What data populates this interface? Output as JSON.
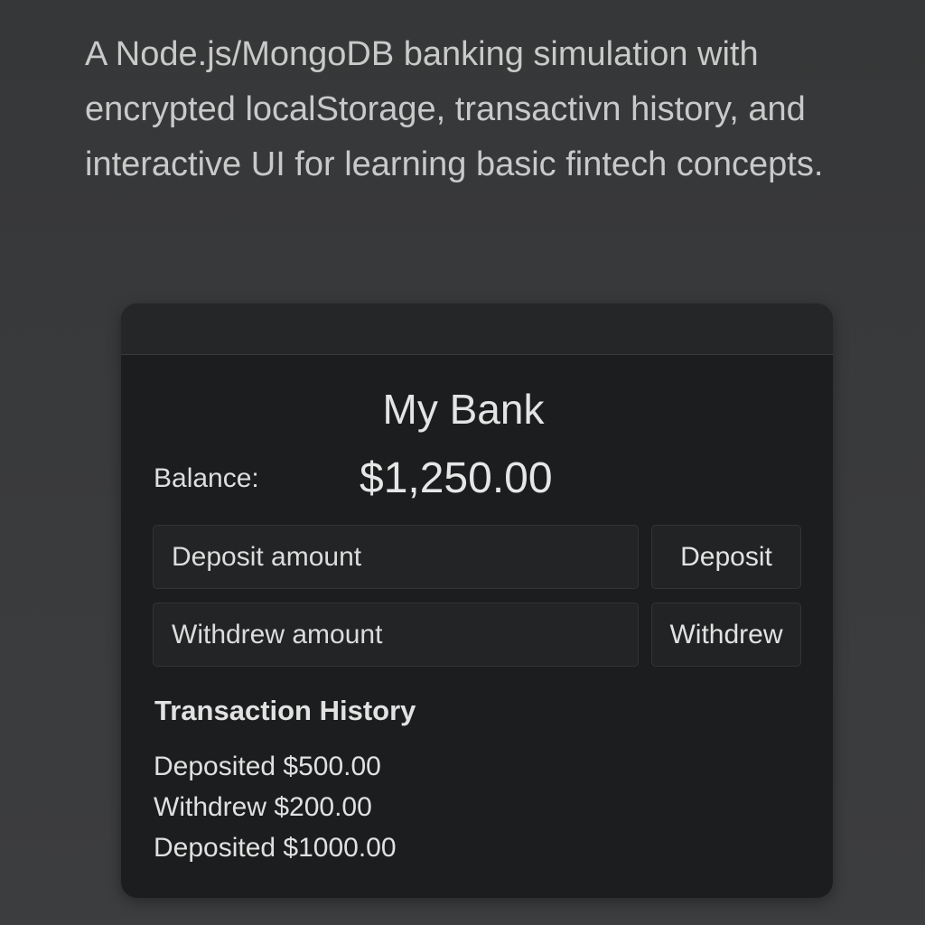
{
  "description": "A Node.js/MongoDB banking simulation with encrypted localStorage, transactivn history, and interactive UI for learning basic fintech concepts.",
  "app": {
    "title": "My Bank",
    "balance_label": "Balance:",
    "balance_value": "$1,250.00"
  },
  "deposit": {
    "placeholder": "Deposit amount",
    "value": "",
    "button_label": "Deposit"
  },
  "withdraw": {
    "placeholder": "Withdrew amount",
    "value": "",
    "button_label": "Withdrew"
  },
  "history": {
    "title": "Transaction History",
    "items": [
      {
        "text": "Deposited $500.00"
      },
      {
        "text": "Withdrew $200.00"
      },
      {
        "text": "Deposited $1000.00"
      }
    ]
  },
  "colors": {
    "page_background": "#38393b",
    "card_background": "#1c1d1e",
    "text": "#e0e0e0"
  }
}
